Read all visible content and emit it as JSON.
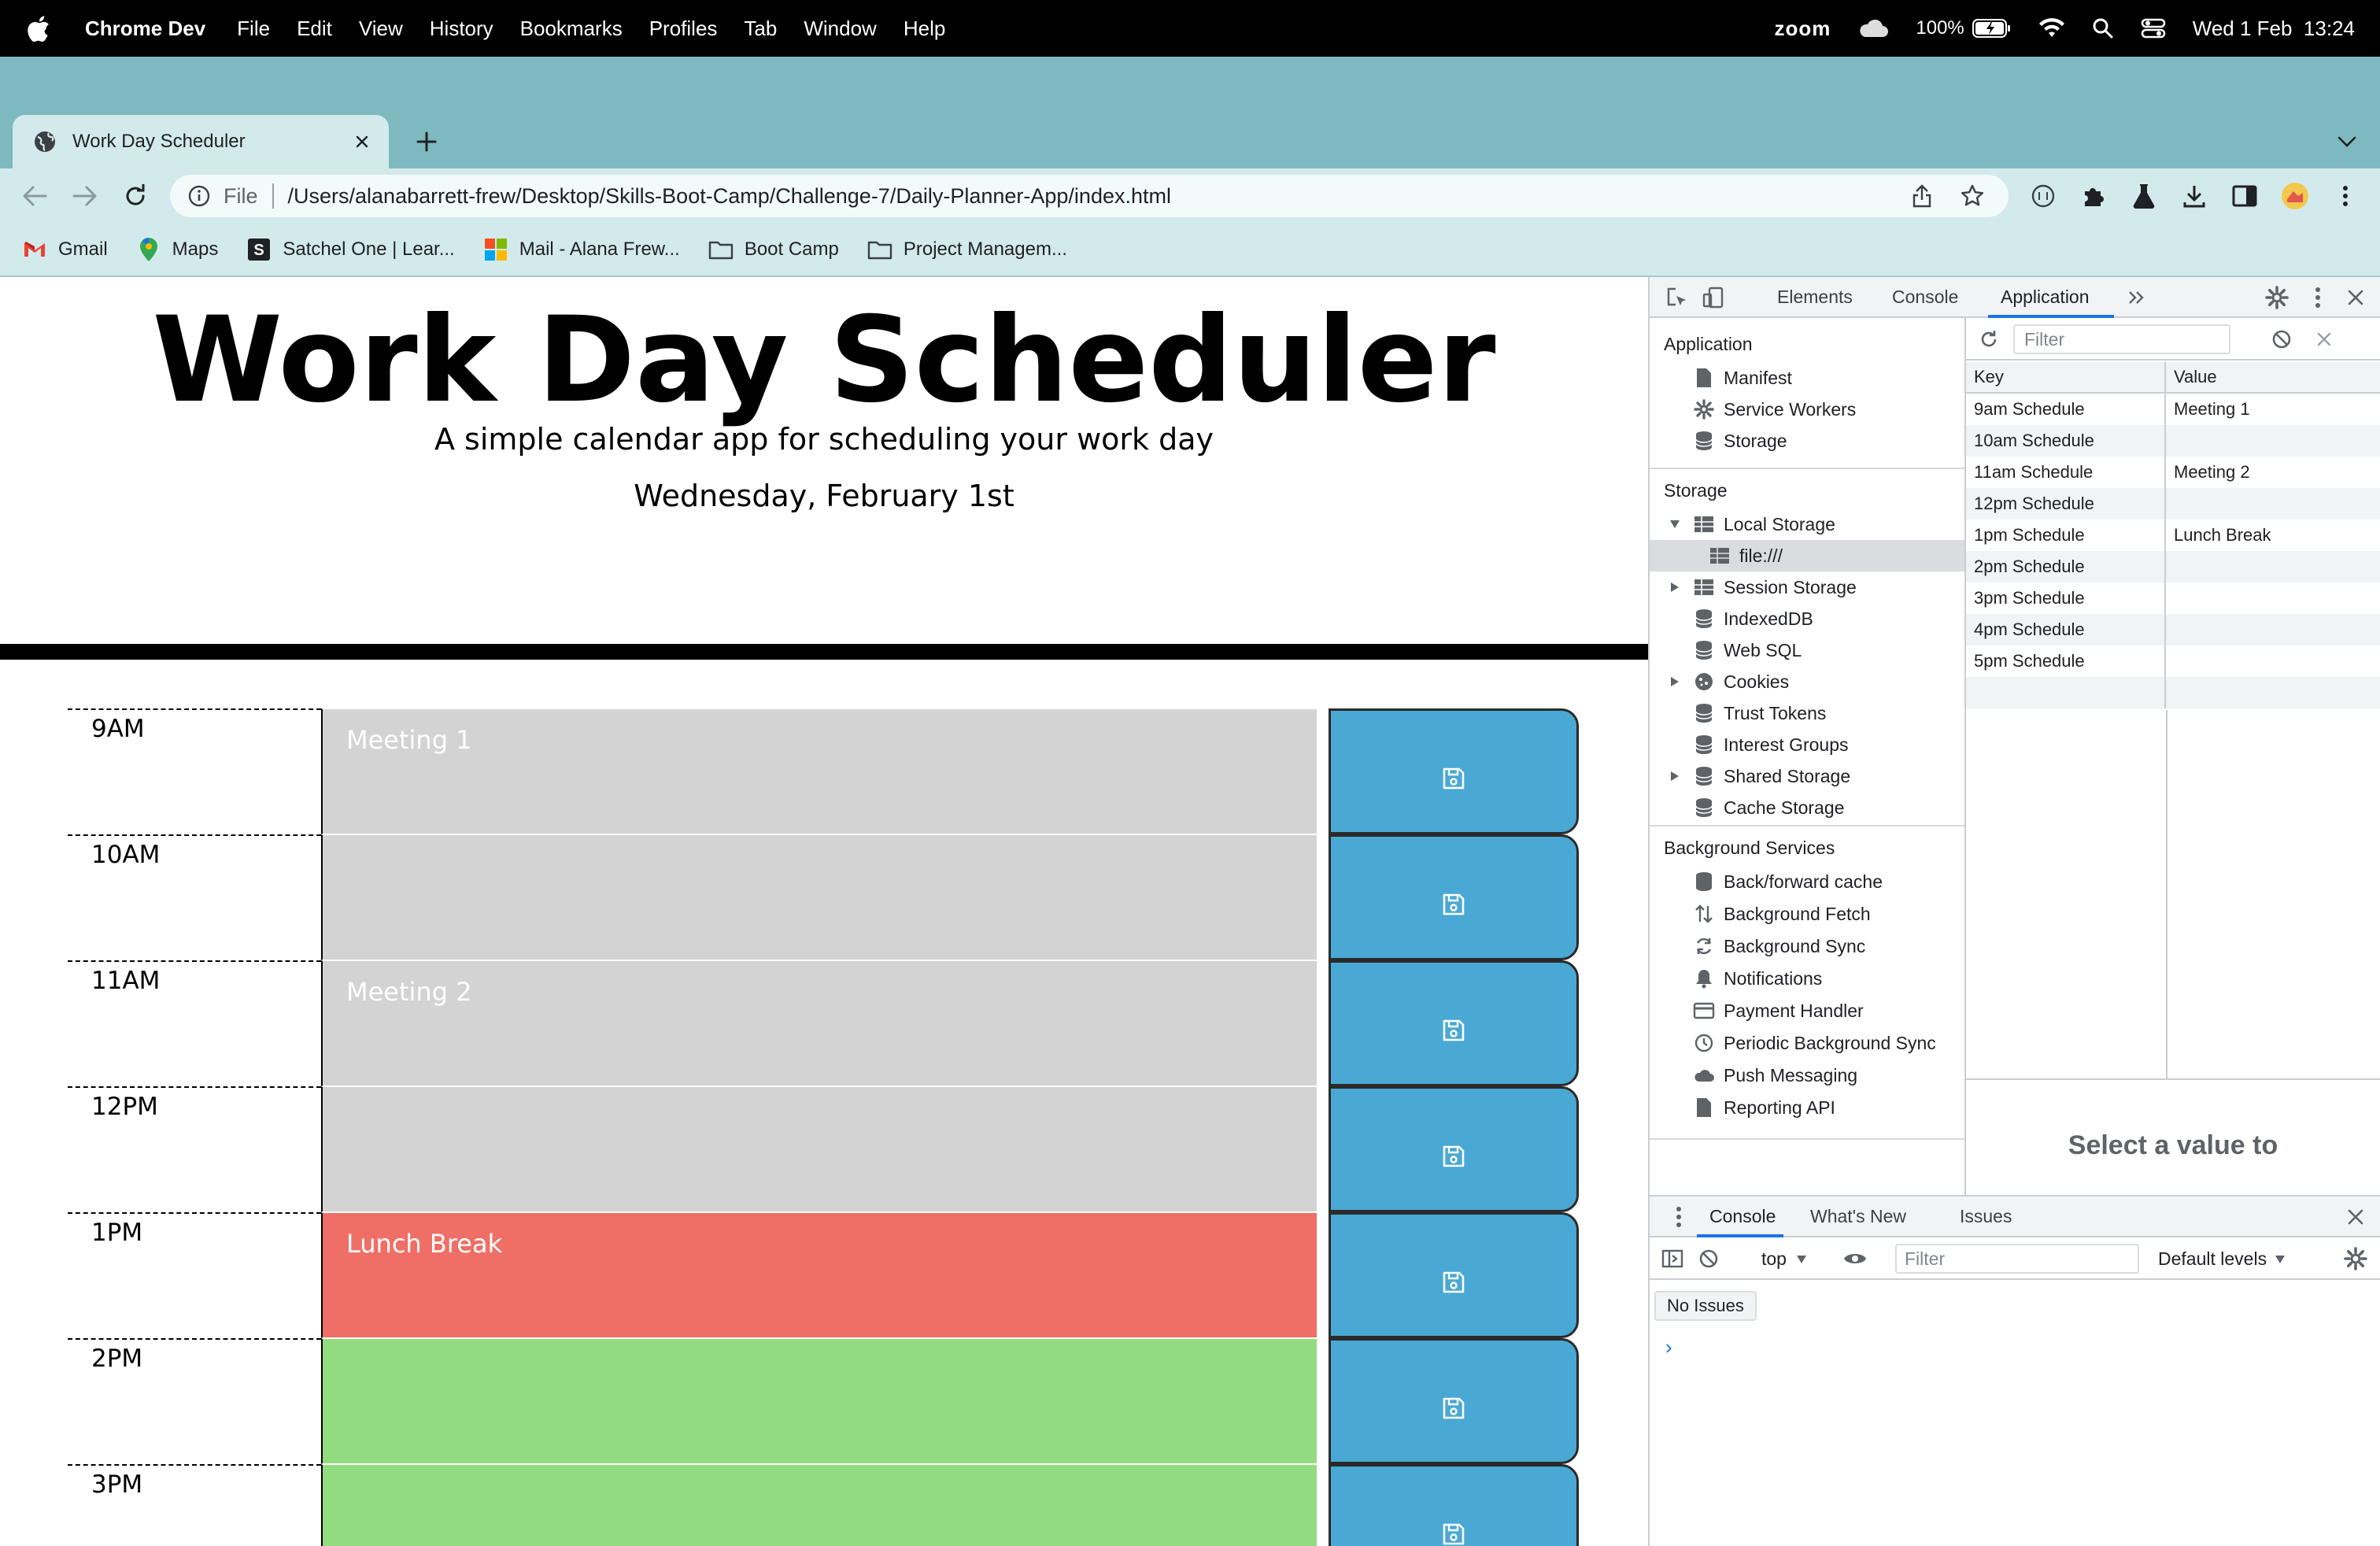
{
  "menubar": {
    "app_name": "Chrome Dev",
    "items": [
      "File",
      "Edit",
      "View",
      "History",
      "Bookmarks",
      "Profiles",
      "Tab",
      "Window",
      "Help"
    ],
    "zoom_label": "zoom",
    "battery": "100%",
    "datetime": "Wed 1 Feb  13:24"
  },
  "browser": {
    "tab_title": "Work Day Scheduler",
    "scheme": "File",
    "url": "/Users/alanabarrett-frew/Desktop/Skills-Boot-Camp/Challenge-7/Daily-Planner-App/index.html",
    "bookmarks": [
      "Gmail",
      "Maps",
      "Satchel One | Lear...",
      "Mail - Alana Frew...",
      "Boot Camp",
      "Project Managem..."
    ]
  },
  "page": {
    "title": "Work Day Scheduler",
    "lead": "A simple calendar app for scheduling your work day",
    "current_day": "Wednesday, February 1st",
    "time_blocks": [
      {
        "hour": "9AM",
        "text": "Meeting 1",
        "state": "past"
      },
      {
        "hour": "10AM",
        "text": "",
        "state": "past"
      },
      {
        "hour": "11AM",
        "text": "Meeting 2",
        "state": "past"
      },
      {
        "hour": "12PM",
        "text": "",
        "state": "past"
      },
      {
        "hour": "1PM",
        "text": "Lunch Break",
        "state": "present"
      },
      {
        "hour": "2PM",
        "text": "",
        "state": "future"
      },
      {
        "hour": "3PM",
        "text": "",
        "state": "future"
      }
    ],
    "colors": {
      "past": "#d3d3d3",
      "present": "#ef6f66",
      "future": "#93db81",
      "save": "#4aa9d4"
    }
  },
  "devtools": {
    "tabs": [
      "Elements",
      "Console",
      "Application"
    ],
    "active_tab": "Application",
    "sidebar": {
      "application_heading": "Application",
      "application_items": [
        "Manifest",
        "Service Workers",
        "Storage"
      ],
      "storage_heading": "Storage",
      "local_storage": "Local Storage",
      "local_storage_origin": "file:///",
      "storage_items": [
        "Session Storage",
        "IndexedDB",
        "Web SQL",
        "Cookies",
        "Trust Tokens",
        "Interest Groups",
        "Shared Storage",
        "Cache Storage"
      ],
      "background_heading": "Background Services",
      "background_items": [
        "Back/forward cache",
        "Background Fetch",
        "Background Sync",
        "Notifications",
        "Payment Handler",
        "Periodic Background Sync",
        "Push Messaging",
        "Reporting API"
      ]
    },
    "filter_placeholder": "Filter",
    "table": {
      "headers": [
        "Key",
        "Value"
      ],
      "rows": [
        {
          "key": "9am Schedule",
          "value": "Meeting 1"
        },
        {
          "key": "10am Schedule",
          "value": ""
        },
        {
          "key": "11am Schedule",
          "value": "Meeting 2"
        },
        {
          "key": "12pm Schedule",
          "value": ""
        },
        {
          "key": "1pm Schedule",
          "value": "Lunch Break"
        },
        {
          "key": "2pm Schedule",
          "value": ""
        },
        {
          "key": "3pm Schedule",
          "value": ""
        },
        {
          "key": "4pm Schedule",
          "value": ""
        },
        {
          "key": "5pm Schedule",
          "value": ""
        }
      ]
    },
    "select_hint": "Select a value to",
    "drawer": {
      "tabs": [
        "Console",
        "What's New",
        "Issues"
      ],
      "context": "top",
      "filter_placeholder": "Filter",
      "levels": "Default levels",
      "no_issues": "No Issues",
      "prompt": "›"
    }
  }
}
